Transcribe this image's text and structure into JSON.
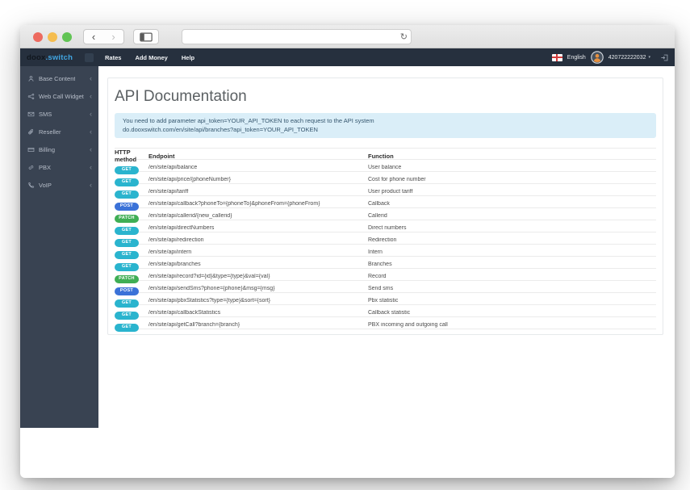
{
  "browser": {
    "url": ""
  },
  "icons": {
    "back": "‹",
    "forward": "›",
    "reload": "↻",
    "collapse": "‹",
    "caret": "▾"
  },
  "navbar": {
    "logo_primary": "doox",
    "logo_accent": ".switch",
    "menu": [
      {
        "label": "Rates"
      },
      {
        "label": "Add Money"
      },
      {
        "label": "Help"
      }
    ],
    "language": "English",
    "account_number": "420722222032"
  },
  "sidebar": {
    "items": [
      {
        "label": "Base Content",
        "icon": "user-icon"
      },
      {
        "label": "Web Call Widget",
        "icon": "share-icon"
      },
      {
        "label": "SMS",
        "icon": "mail-icon"
      },
      {
        "label": "Reseller",
        "icon": "paperclip-icon"
      },
      {
        "label": "Billing",
        "icon": "billing-icon"
      },
      {
        "label": "PBX",
        "icon": "link-icon"
      },
      {
        "label": "VoIP",
        "icon": "phone-icon"
      }
    ]
  },
  "main": {
    "title": "API Documentation",
    "alert": {
      "line1": "You need to add parameter api_token=YOUR_API_TOKEN to each request to the API system",
      "line2": "do.dooxswitch.com/en/site/api/branches?api_token=YOUR_API_TOKEN"
    },
    "table": {
      "headers": [
        "HTTP method",
        "Endpoint",
        "Function"
      ],
      "rows": [
        {
          "method": "GET",
          "endpoint": "/en/site/api/balance",
          "function": "User balance"
        },
        {
          "method": "GET",
          "endpoint": "/en/site/api/price/{phoneNumber}",
          "function": "Cost for phone number"
        },
        {
          "method": "GET",
          "endpoint": "/en/site/api/tariff",
          "function": "User product tariff"
        },
        {
          "method": "POST",
          "endpoint": "/en/site/api/callback?phoneTo={phoneTo}&phoneFrom={phoneFrom}",
          "function": "Callback"
        },
        {
          "method": "PATCH",
          "endpoint": "/en/site/api/callerid/{new_callerid}",
          "function": "Callerid"
        },
        {
          "method": "GET",
          "endpoint": "/en/site/api/directNumbers",
          "function": "Direct numbers"
        },
        {
          "method": "GET",
          "endpoint": "/en/site/api/redirection",
          "function": "Redirection"
        },
        {
          "method": "GET",
          "endpoint": "/en/site/api/intern",
          "function": "Intern"
        },
        {
          "method": "GET",
          "endpoint": "/en/site/api/branches",
          "function": "Branches"
        },
        {
          "method": "PATCH",
          "endpoint": "/en/site/api/record?id={id}&type={type}&val={val}",
          "function": "Record"
        },
        {
          "method": "POST",
          "endpoint": "/en/site/api/sendSms?phone={phone}&msg={msg}",
          "function": "Send sms"
        },
        {
          "method": "GET",
          "endpoint": "/en/site/api/pbxStatistics?type={type}&sort={sort}",
          "function": "Pbx statistic"
        },
        {
          "method": "GET",
          "endpoint": "/en/site/api/callbackStatistics",
          "function": "Callback statistic"
        },
        {
          "method": "GET",
          "endpoint": "/en/site/api/getCall?branch={branch}",
          "function": "PBX incoming and outgoing call"
        }
      ]
    }
  },
  "colors": {
    "navbar_bg": "#26303e",
    "sidebar_bg": "#394352",
    "logo_accent": "#41a5e1",
    "alert_bg": "#daeef8",
    "method_get": "#2ab4ce",
    "method_post": "#3b72d8",
    "method_patch": "#3fae54"
  }
}
